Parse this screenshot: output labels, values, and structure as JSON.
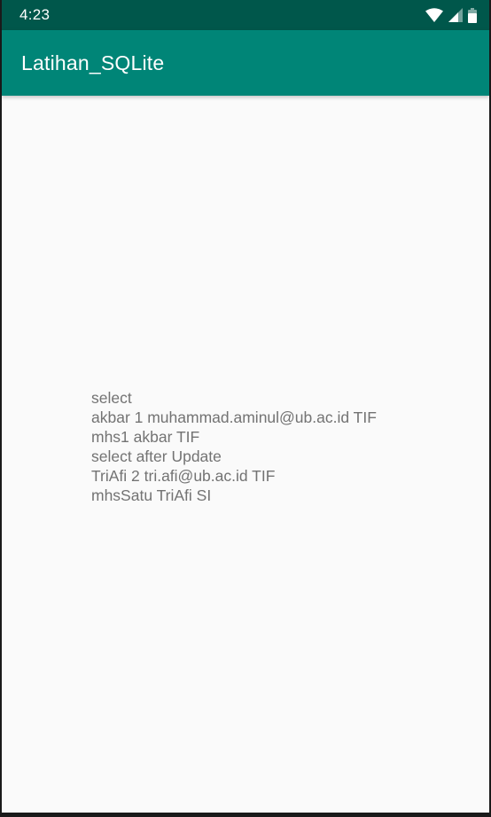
{
  "status_bar": {
    "time": "4:23",
    "icons": [
      "wifi-icon",
      "cellular-signal-icon",
      "battery-icon"
    ],
    "color": "#00574b"
  },
  "app_bar": {
    "title": "Latihan_SQLite",
    "color": "#008577"
  },
  "content": {
    "lines": [
      "select",
      "akbar 1 muhammad.aminul@ub.ac.id TIF",
      "mhs1 akbar TIF",
      "select after Update",
      "TriAfi 2 tri.afi@ub.ac.id TIF",
      "mhsSatu TriAfi SI"
    ],
    "text_color": "#737373"
  }
}
